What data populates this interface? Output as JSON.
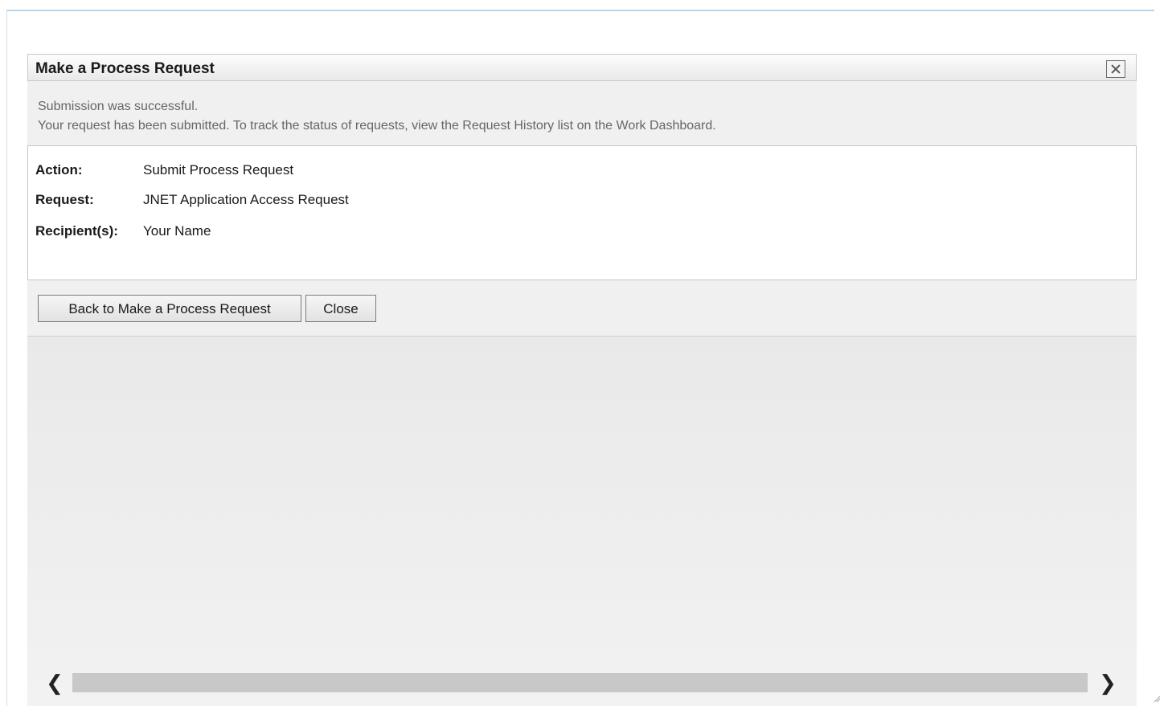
{
  "dialog": {
    "title": "Make a Process Request",
    "status_line1": "Submission was successful.",
    "status_line2": "Your request has been submitted. To track the status of requests, view the Request History list on the Work Dashboard.",
    "details": [
      {
        "label": "Action:",
        "value": "Submit Process Request"
      },
      {
        "label": "Request:",
        "value": "JNET Application Access Request"
      },
      {
        "label": "Recipient(s):",
        "value": "Your Name"
      }
    ],
    "buttons": {
      "back_label": "Back to Make a Process Request",
      "close_label": "Close"
    }
  },
  "scrollbar": {
    "left_arrow": "❮",
    "right_arrow": "❯"
  },
  "icons": {
    "close": "close-icon",
    "scroll_left": "chevron-left-icon",
    "scroll_right": "chevron-right-icon",
    "resize": "resize-grip-icon"
  },
  "colors": {
    "header_bg": "#e9e9e9",
    "panel_bg": "#f0f0f0",
    "status_text": "#666666",
    "accent_line": "#b9d3ea"
  }
}
